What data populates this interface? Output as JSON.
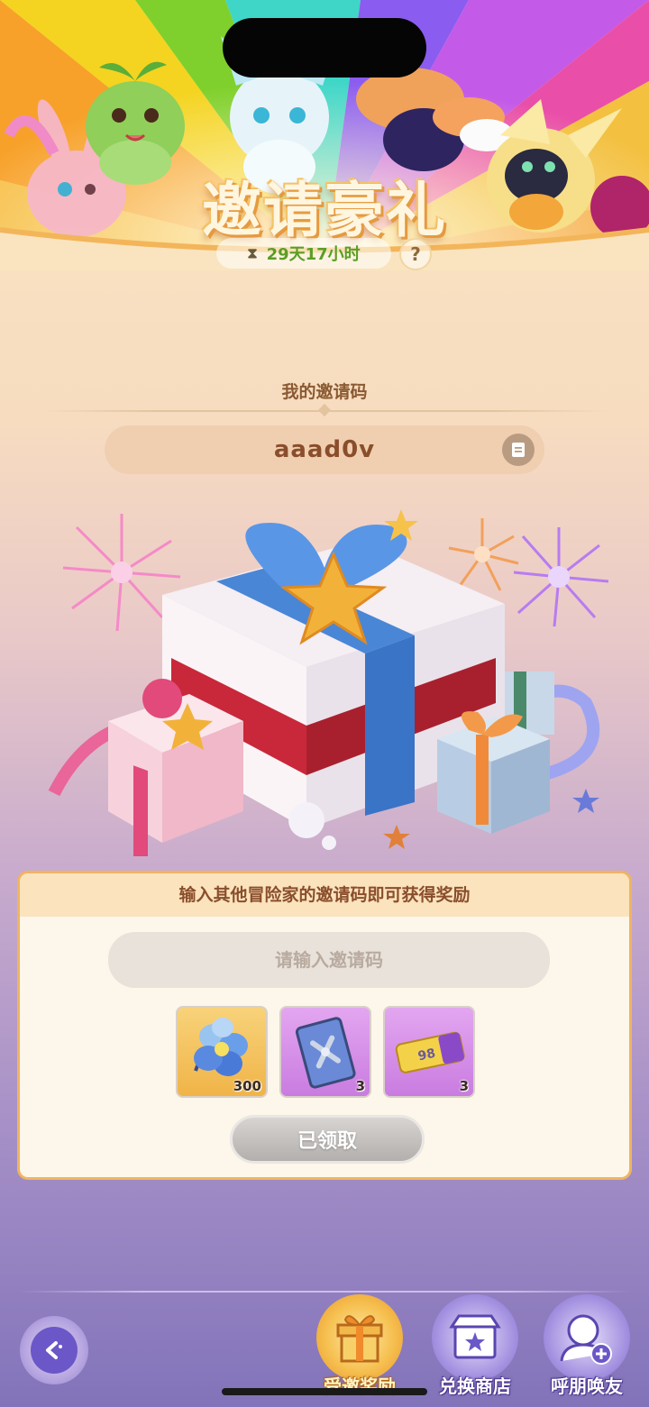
{
  "banner": {
    "title": "邀请豪礼",
    "timer": "29天17小时",
    "help_label": "?"
  },
  "my_invite": {
    "label": "我的邀请码",
    "code": "aaad0v"
  },
  "reward_panel": {
    "header": "输入其他冒险家的邀请码即可获得奖励",
    "input_placeholder": "请输入邀请码",
    "input_value": "",
    "rewards": [
      {
        "icon": "blue-flower-icon",
        "count": "300"
      },
      {
        "icon": "card-icon",
        "count": "3"
      },
      {
        "icon": "ticket-icon",
        "ticket_text": "98",
        "count": "3"
      }
    ],
    "claim_label": "已领取"
  },
  "bottom_nav": {
    "items": [
      {
        "label": "受邀奖励",
        "icon": "gift-box-icon"
      },
      {
        "label": "兑换商店",
        "icon": "shop-icon"
      },
      {
        "label": "呼朋唤友",
        "icon": "add-friend-icon"
      }
    ]
  },
  "colors": {
    "accent_orange": "#f0b460",
    "text_brown": "#8a4e2c",
    "timer_green": "#5a9e24",
    "nav_purple": "#6b57c8"
  }
}
